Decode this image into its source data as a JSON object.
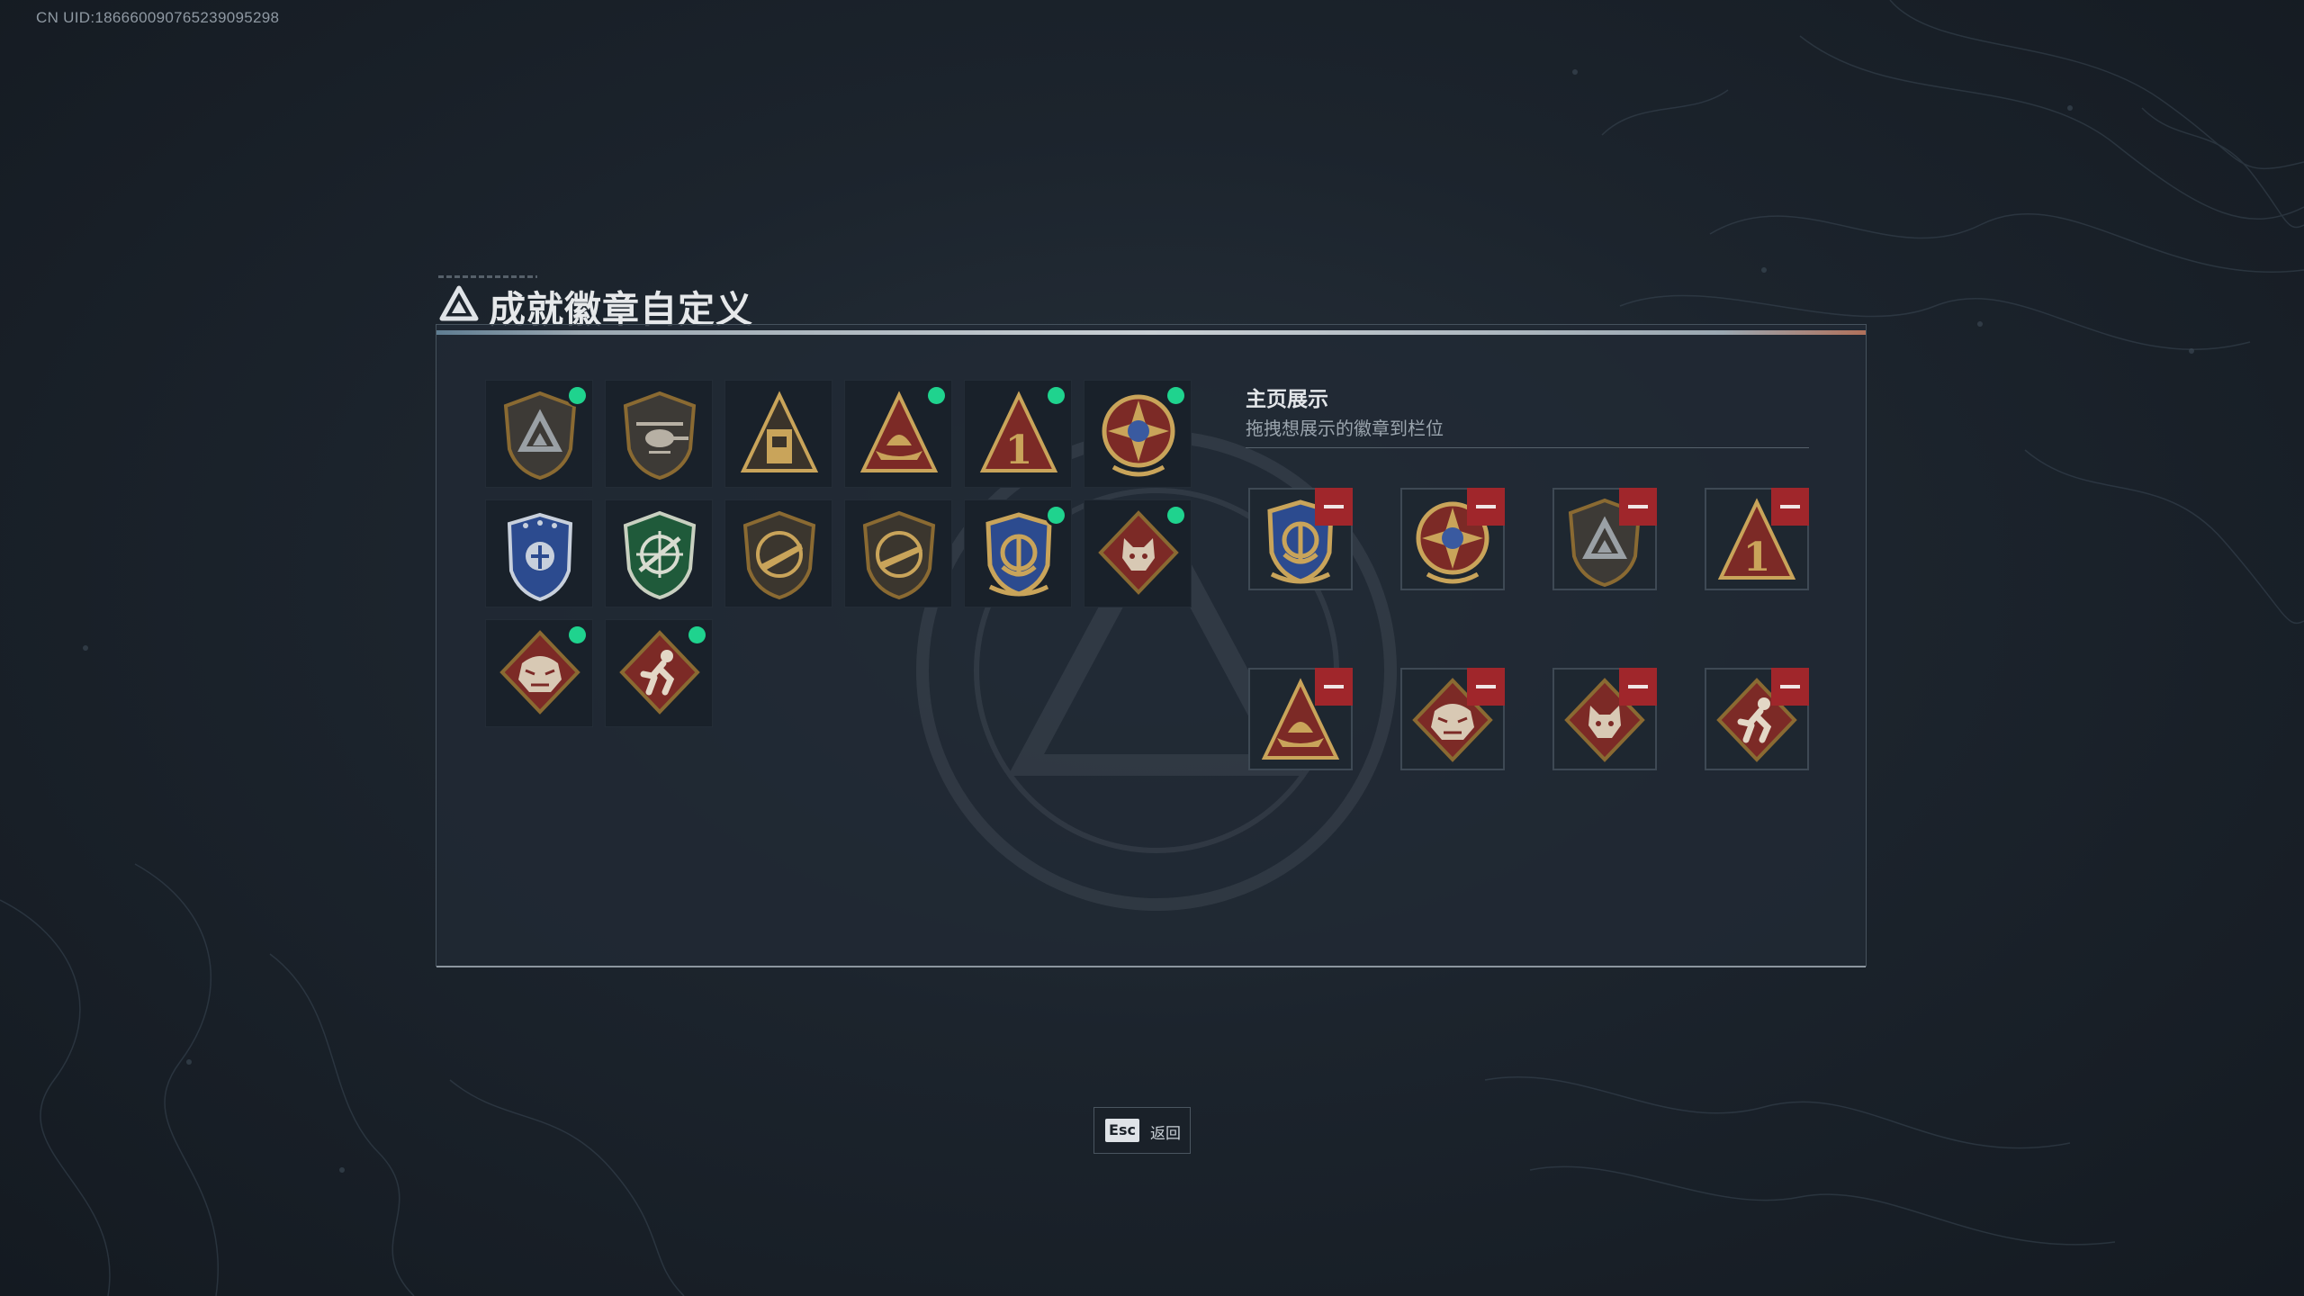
{
  "header": {
    "uid": "CN UID:1866600907652390952​98"
  },
  "panel": {
    "title": "成就徽章自定义"
  },
  "inventory": {
    "badges": [
      {
        "name": "shield-triangle-badge",
        "owned_marker": true
      },
      {
        "name": "helicopter-badge",
        "owned_marker": false
      },
      {
        "name": "tower-badge",
        "owned_marker": false
      },
      {
        "name": "boat-triangle-badge",
        "owned_marker": true
      },
      {
        "name": "number-one-badge",
        "owned_marker": true
      },
      {
        "name": "star-medal-badge",
        "owned_marker": true
      },
      {
        "name": "blue-shield-badge",
        "owned_marker": false
      },
      {
        "name": "green-target-badge",
        "owned_marker": false
      },
      {
        "name": "rifle-shield-badge",
        "owned_marker": false
      },
      {
        "name": "rifle-shield-badge-2",
        "owned_marker": false
      },
      {
        "name": "anchor-shield-badge",
        "owned_marker": true
      },
      {
        "name": "wolf-badge",
        "owned_marker": true
      },
      {
        "name": "dragon-badge",
        "owned_marker": true
      },
      {
        "name": "runner-badge",
        "owned_marker": true
      }
    ]
  },
  "showcase": {
    "title": "主页展示",
    "subtitle": "拖拽想展示的徽章到栏位",
    "slots": [
      {
        "badge": "anchor-shield-badge"
      },
      {
        "badge": "star-medal-badge"
      },
      {
        "badge": "shield-triangle-badge"
      },
      {
        "badge": "number-one-badge"
      },
      {
        "badge": "boat-triangle-badge"
      },
      {
        "badge": "dragon-badge"
      },
      {
        "badge": "wolf-badge"
      },
      {
        "badge": "runner-badge"
      }
    ]
  },
  "footer": {
    "esc_key": "Esc",
    "esc_label": "返回"
  },
  "colors": {
    "accent_green": "#1fd38e",
    "remove_red": "#a0262b",
    "gold": "#c9a45a"
  }
}
